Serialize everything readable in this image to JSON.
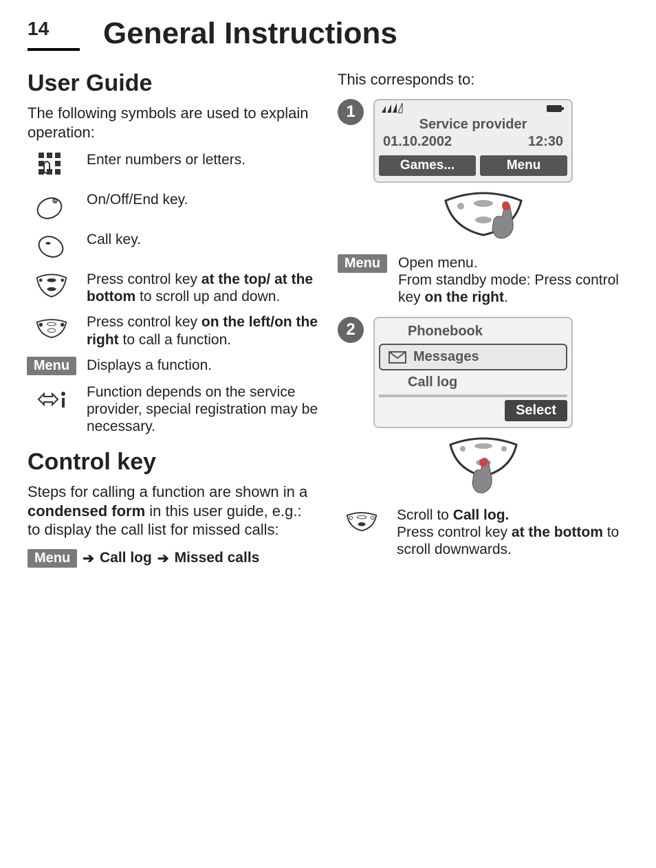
{
  "page": {
    "number": "14",
    "title": "General Instructions"
  },
  "left": {
    "section1_title": "User Guide",
    "intro": "The following symbols are used to explain operation:",
    "symbols": [
      {
        "name": "keypad-icon",
        "text": "Enter numbers or letters."
      },
      {
        "name": "end-key-icon",
        "text": "On/Off/End key."
      },
      {
        "name": "call-key-icon",
        "text": "Call key."
      },
      {
        "name": "controlkey-vertical-icon",
        "pre": "Press control key ",
        "bold": "at the top/ at the bottom",
        "post": " to scroll up and down."
      },
      {
        "name": "controlkey-horizontal-icon",
        "pre": "Press control key ",
        "bold": "on the left/on the right",
        "post": " to call a function."
      },
      {
        "name": "menu-badge",
        "label": "Menu",
        "text": "Displays a function."
      },
      {
        "name": "provider-icon",
        "text": "Function depends on the service provider, special registration may be necessary."
      }
    ],
    "section2_title": "Control key",
    "ck_text_pre": "Steps for calling a function are shown in a ",
    "ck_text_bold": "condensed form",
    "ck_text_post": " in this user guide, e.g.: to display the call list for missed calls:",
    "breadcrumb": {
      "menu": "Menu",
      "step1": "Call log",
      "step2": "Missed calls"
    }
  },
  "right": {
    "corresponds": "This corresponds to:",
    "step1_num": "1",
    "screen1": {
      "provider": "Service provider",
      "date": "01.10.2002",
      "time": "12:30",
      "soft_left": "Games...",
      "soft_right": "Menu"
    },
    "menu_badge": "Menu",
    "open_menu": "Open menu.",
    "open_menu_desc_pre": "From standby mode: Press control key ",
    "open_menu_desc_bold": "on the right",
    "open_menu_desc_post": ".",
    "step2_num": "2",
    "screen2": {
      "item1": "Phonebook",
      "item2": "Messages",
      "item3": "Call log",
      "select": "Select"
    },
    "scroll_pre": "Scroll to ",
    "scroll_bold": "Call log.",
    "scroll_desc_pre": "Press control key ",
    "scroll_desc_bold": "at the bottom",
    "scroll_desc_post": " to scroll downwards."
  }
}
